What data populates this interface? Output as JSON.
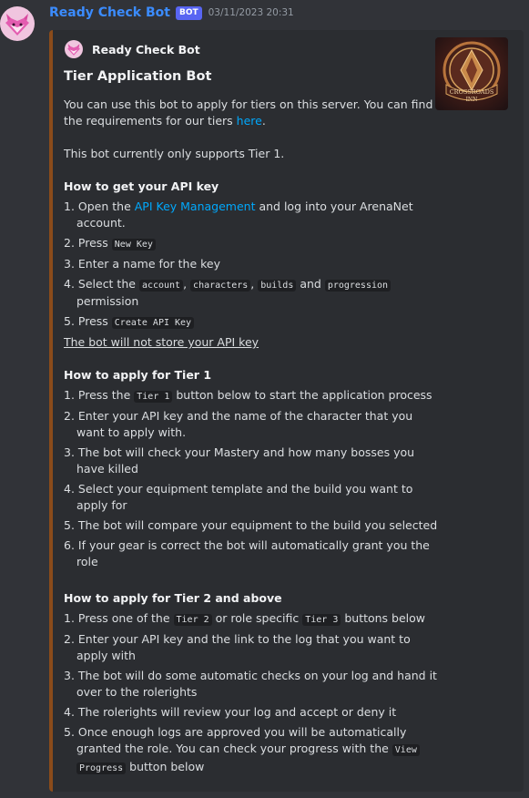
{
  "message": {
    "username": "Ready Check Bot",
    "bot_tag": "BOT",
    "timestamp": "03/11/2023 20:31",
    "avatar_icon": "fox-mascot-icon"
  },
  "embed": {
    "accent_color": "#8a4b1a",
    "author": "Ready Check Bot",
    "thumbnail_text": [
      "CROSSROADS",
      "INN"
    ],
    "title": "Tier Application Bot",
    "intro": {
      "line1": "You can use this bot to apply for tiers on this server. You can find",
      "line2_pre": "the requirements for our tiers ",
      "line2_link": "here",
      "line2_post": "."
    },
    "support_note": "This bot currently only supports Tier 1.",
    "api_key": {
      "heading": "How to get your API key",
      "s1_pre": "1. Open the ",
      "s1_link": "API Key Management",
      "s1_post": " and log into your ArenaNet",
      "s1_cont": "account.",
      "s2_pre": "2. Press ",
      "s2_code": "New Key",
      "s3": "3. Enter a name for the key",
      "s4_pre": "4. Select the ",
      "s4_c1": "account",
      "s4_sep1": ", ",
      "s4_c2": "characters",
      "s4_sep2": ", ",
      "s4_c3": "builds",
      "s4_and": " and ",
      "s4_c4": "progression",
      "s4_cont": "permission",
      "s5_pre": "5. Press ",
      "s5_code": "Create API Key",
      "note": "The bot will not store your API key"
    },
    "tier1": {
      "heading": "How to apply for Tier 1",
      "s1_pre": "1. Press the ",
      "s1_code": "Tier 1",
      "s1_post": " button below to start the application process",
      "s2": "2. Enter your API key and the name of the character that you",
      "s2_cont": "want to apply with.",
      "s3": "3. The bot will check your Mastery and how many bosses you",
      "s3_cont": "have killed",
      "s4": "4. Select your equipment template and the build you want to",
      "s4_cont": "apply for",
      "s5": "5. The bot will compare your equipment to the build you selected",
      "s6": "6. If your gear is correct the bot will automatically grant you the",
      "s6_cont": "role"
    },
    "tier2": {
      "heading": "How to apply for Tier 2 and above",
      "s1_pre": "1. Press one of the ",
      "s1_code1": "Tier 2",
      "s1_mid": " or role specific ",
      "s1_code2": "Tier 3",
      "s1_post": " buttons below",
      "s2": "2. Enter your API key and the link to the log that you want to",
      "s2_cont": "apply with",
      "s3": "3. The bot will do some automatic checks on your log and hand it",
      "s3_cont": "over to the rolerights",
      "s4": "4. The rolerights will review your log and accept or deny it",
      "s5": "5. Once enough logs are approved you will be automatically",
      "s5_cont_pre": "granted the role. You can check your progress with the ",
      "s5_code_a": "View",
      "s5_code_b": "Progress",
      "s5_post": " button below"
    }
  }
}
